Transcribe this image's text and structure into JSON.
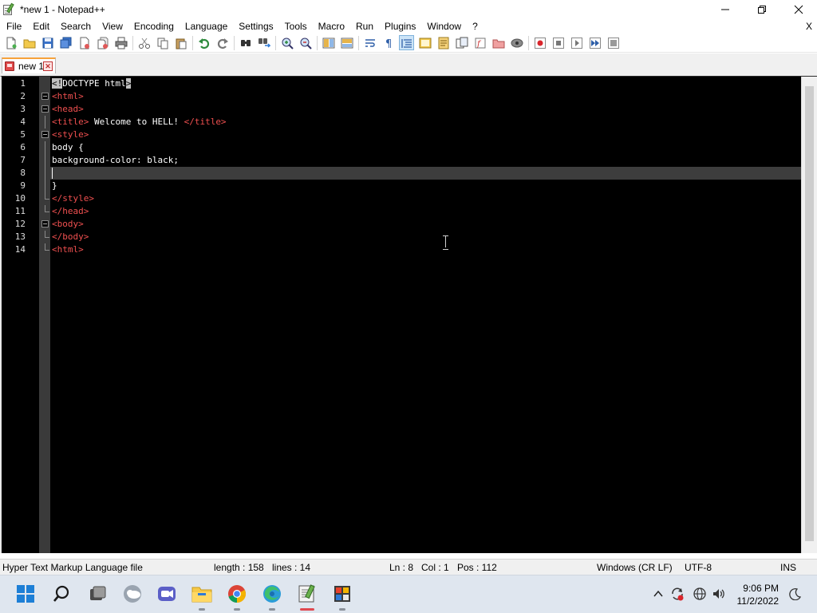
{
  "window": {
    "title": "*new 1 - Notepad++",
    "controls": {
      "minimize": "—",
      "maximize": "❐",
      "close": "✕"
    }
  },
  "menu": {
    "items": [
      "File",
      "Edit",
      "Search",
      "View",
      "Encoding",
      "Language",
      "Settings",
      "Tools",
      "Macro",
      "Run",
      "Plugins",
      "Window",
      "?"
    ],
    "close_doc": "X"
  },
  "toolbar": {
    "icons": [
      "new-file-icon",
      "open-file-icon",
      "save-icon",
      "save-all-icon",
      "close-icon",
      "close-all-icon",
      "print-icon",
      "cut-icon",
      "copy-icon",
      "paste-icon",
      "undo-icon",
      "redo-icon",
      "find-icon",
      "replace-icon",
      "zoom-in-icon",
      "zoom-out-icon",
      "sync-vertical-icon",
      "sync-horizontal-icon",
      "word-wrap-icon",
      "show-all-characters-icon",
      "indent-guide-icon",
      "user-defined-language-icon",
      "document-map-icon",
      "document-list-icon",
      "function-list-icon",
      "folder-as-workspace-icon",
      "monitoring-icon",
      "record-macro-icon",
      "stop-recording-icon",
      "playback-icon",
      "run-macro-multiple-icon",
      "save-macro-icon"
    ]
  },
  "tabs": [
    {
      "label": "new 1",
      "close": "✕"
    }
  ],
  "editor": {
    "current_line": 8,
    "lines": [
      {
        "n": "1",
        "segments": [
          {
            "t": "<!",
            "c": "hl"
          },
          {
            "t": "DOCTYPE html",
            "c": "txt"
          },
          {
            "t": ">",
            "c": "hl"
          }
        ],
        "fold": ""
      },
      {
        "n": "2",
        "segments": [
          {
            "t": "<html>",
            "c": "tag"
          }
        ],
        "fold": "open"
      },
      {
        "n": "3",
        "segments": [
          {
            "t": "<head>",
            "c": "tag"
          }
        ],
        "fold": "open"
      },
      {
        "n": "4",
        "segments": [
          {
            "t": "<title>",
            "c": "tag"
          },
          {
            "t": " Welcome to HELL! ",
            "c": "txt"
          },
          {
            "t": "</title>",
            "c": "tag"
          }
        ],
        "fold": "line"
      },
      {
        "n": "5",
        "segments": [
          {
            "t": "<style>",
            "c": "tag"
          }
        ],
        "fold": "open"
      },
      {
        "n": "6",
        "segments": [
          {
            "t": "body {",
            "c": "txt"
          }
        ],
        "fold": "line"
      },
      {
        "n": "7",
        "segments": [
          {
            "t": "background-color: black;",
            "c": "txt"
          }
        ],
        "fold": "line"
      },
      {
        "n": "8",
        "segments": [
          {
            "t": "",
            "c": "txt"
          }
        ],
        "fold": "line"
      },
      {
        "n": "9",
        "segments": [
          {
            "t": "}",
            "c": "txt"
          }
        ],
        "fold": "line"
      },
      {
        "n": "10",
        "segments": [
          {
            "t": "</style>",
            "c": "tag"
          }
        ],
        "fold": "end"
      },
      {
        "n": "11",
        "segments": [
          {
            "t": "</head>",
            "c": "tag"
          }
        ],
        "fold": "end"
      },
      {
        "n": "12",
        "segments": [
          {
            "t": "<body>",
            "c": "tag"
          }
        ],
        "fold": "open"
      },
      {
        "n": "13",
        "segments": [
          {
            "t": "</body>",
            "c": "tag"
          }
        ],
        "fold": "end"
      },
      {
        "n": "14",
        "segments": [
          {
            "t": "<html>",
            "c": "tag"
          }
        ],
        "fold": "end"
      }
    ]
  },
  "status": {
    "file_type": "Hyper Text Markup Language file",
    "length": "length : 158",
    "lines": "lines : 14",
    "ln": "Ln : 8",
    "col": "Col : 1",
    "pos": "Pos : 112",
    "eol": "Windows (CR LF)",
    "encoding": "UTF-8",
    "mode": "INS"
  },
  "taskbar": {
    "apps": [
      "windows-start-icon",
      "search-icon",
      "task-view-icon",
      "widgets-icon",
      "teams-chat-icon",
      "file-explorer-icon",
      "chrome-icon",
      "edge-icon",
      "notepadpp-icon",
      "media-app-icon"
    ],
    "tray": [
      "chevron-up-icon",
      "sync-icon",
      "network-icon",
      "volume-icon"
    ],
    "time": "9:06 PM",
    "date": "11/2/2022",
    "focus_icon": "focus-assist-icon"
  },
  "colors": {
    "tag": "#f05050",
    "text": "#ffffff",
    "editor_bg": "#000000",
    "current_line": "#3d3d3d",
    "taskbar_bg": "#dfe6ef",
    "accent_running": "#e0484f"
  }
}
